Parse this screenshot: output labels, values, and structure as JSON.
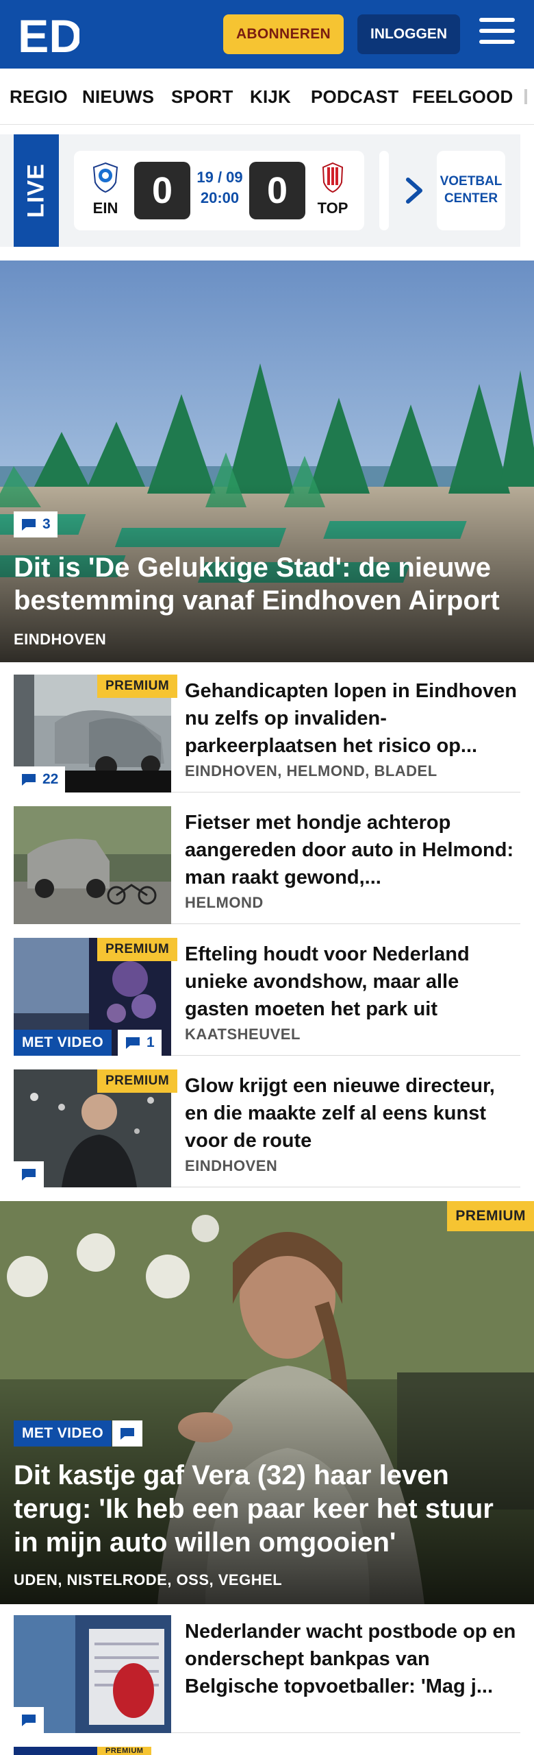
{
  "header": {
    "logo_text": "ED",
    "subscribe_label": "ABONNEREN",
    "login_label": "INLOGGEN"
  },
  "nav": {
    "items": [
      "REGIO",
      "NIEUWS",
      "SPORT",
      "KIJK",
      "PODCAST",
      "FEELGOOD"
    ]
  },
  "live": {
    "badge": "LIVE",
    "home_team": "EIN",
    "away_team": "TOP",
    "home_score": "0",
    "away_score": "0",
    "date": "19 / 09",
    "time": "20:00",
    "voetbal_line1": "VOETBAL",
    "voetbal_line2": "CENTER"
  },
  "hero": {
    "comments": "3",
    "title": "Dit is 'De Gelukkige Stad': de nieuwe bestemming vanaf Eindhoven Airport",
    "location": "EINDHOVEN"
  },
  "articles": [
    {
      "premium": "PREMIUM",
      "comments": "22",
      "title": "Gehandicapten lopen in Eindhoven nu zelfs op invaliden­parkeerplaatsen het risico op...",
      "location": "EINDHOVEN, HELMOND, BLADEL"
    },
    {
      "title": "Fietser met hondje achterop aangereden door auto in Helmond: man raakt gewond,...",
      "location": "HELMOND"
    },
    {
      "premium": "PREMIUM",
      "video": "MET VIDEO",
      "comments": "1",
      "title": "Efteling houdt voor Nederland unieke avondshow, maar alle gasten moeten het park uit",
      "location": "KAATSHEUVEL"
    },
    {
      "premium": "PREMIUM",
      "title": "Glow krijgt een nieuwe directeur, en die maakte zelf al eens kunst voor de route",
      "location": "EINDHOVEN"
    }
  ],
  "feature": {
    "premium": "PREMIUM",
    "video": "MET VIDEO",
    "title": "Dit kastje gaf Vera (32) haar leven terug: 'Ik heb een paar keer het stuur in mijn auto willen omgooien'",
    "location": "UDEN, NISTELRODE, OSS, VEGHEL"
  },
  "bottom_article": {
    "title": "Nederlander wacht postbode op en onderschept bankpas van Belgische topvoetballer: 'Mag j...",
    "next_premium": "PREMIUM"
  },
  "colors": {
    "brand_blue": "#0f4ea8",
    "accent_yellow": "#f6c432",
    "dark_blue": "#0c3679"
  }
}
